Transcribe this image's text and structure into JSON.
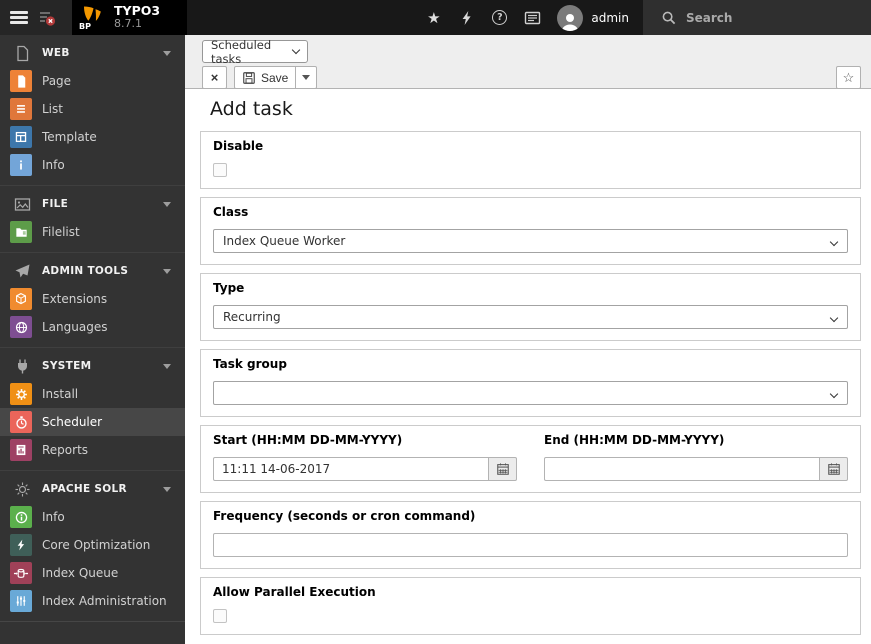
{
  "topbar": {
    "product": "TYPO3",
    "version": "8.7.1",
    "logo_badge": "BP",
    "user": "admin",
    "search_label": "Search"
  },
  "icons": {
    "star": "★",
    "help": "?",
    "close": "×",
    "bookmark": "☆"
  },
  "docheader": {
    "module_select": "Scheduled tasks",
    "save": "Save"
  },
  "page": {
    "title": "Add task"
  },
  "sidebar": {
    "sections": [
      {
        "label": "WEB",
        "items": [
          {
            "label": "Page",
            "color": "#ee8237"
          },
          {
            "label": "List",
            "color": "#e0773b"
          },
          {
            "label": "Template",
            "color": "#3d77ab"
          },
          {
            "label": "Info",
            "color": "#73a5d8"
          }
        ]
      },
      {
        "label": "FILE",
        "items": [
          {
            "label": "Filelist",
            "color": "#5d9c49"
          }
        ]
      },
      {
        "label": "ADMIN TOOLS",
        "items": [
          {
            "label": "Extensions",
            "color": "#f08b2f"
          },
          {
            "label": "Languages",
            "color": "#7e4e92"
          }
        ]
      },
      {
        "label": "SYSTEM",
        "items": [
          {
            "label": "Install",
            "color": "#f09015"
          },
          {
            "label": "Scheduler",
            "color": "#eb655a"
          },
          {
            "label": "Reports",
            "color": "#9e4164"
          }
        ]
      },
      {
        "label": "APACHE SOLR",
        "items": [
          {
            "label": "Info",
            "color": "#5bb04c"
          },
          {
            "label": "Core Optimization",
            "color": "#3f5f58"
          },
          {
            "label": "Index Queue",
            "color": "#a04158"
          },
          {
            "label": "Index Administration",
            "color": "#69a9d7"
          }
        ]
      }
    ]
  },
  "form": {
    "disable": {
      "label": "Disable"
    },
    "task_class": {
      "label": "Class",
      "value": "Index Queue Worker"
    },
    "task_type": {
      "label": "Type",
      "value": "Recurring"
    },
    "task_group": {
      "label": "Task group",
      "value": ""
    },
    "start": {
      "label": "Start (HH:MM DD-MM-YYYY)",
      "value": "11:11 14-06-2017"
    },
    "end": {
      "label": "End (HH:MM DD-MM-YYYY)",
      "value": ""
    },
    "frequency": {
      "label": "Frequency (seconds or cron command)",
      "value": ""
    },
    "parallel": {
      "label": "Allow Parallel Execution"
    }
  }
}
